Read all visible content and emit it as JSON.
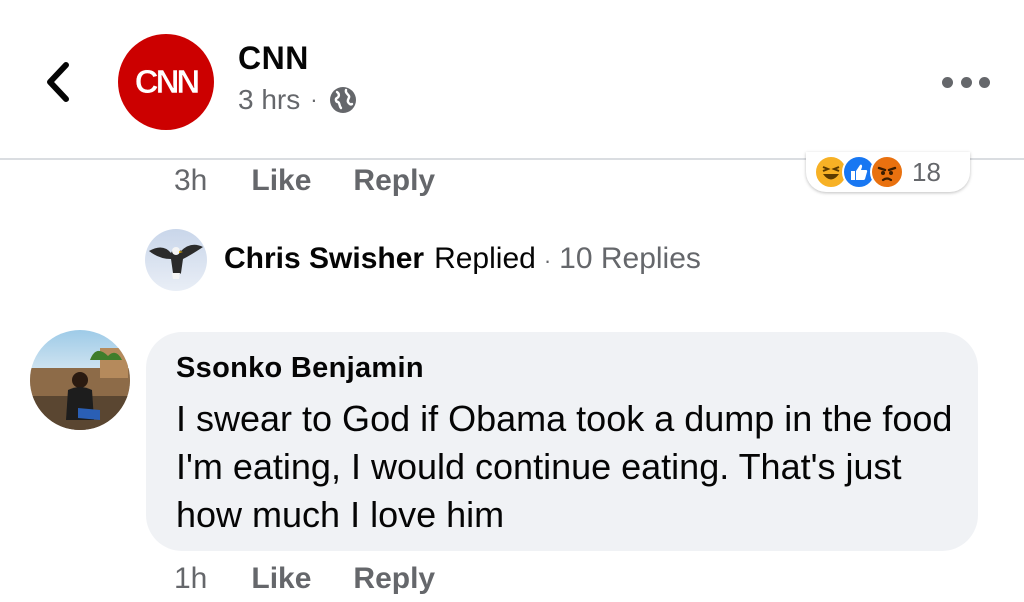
{
  "header": {
    "page_name": "CNN",
    "logo_text": "CNN",
    "time_ago": "3 hrs",
    "separator": "·",
    "back_icon": "chevron-left-icon",
    "privacy_icon": "globe-icon",
    "more_icon": "more-horizontal-icon"
  },
  "first_comment": {
    "time": "3h",
    "like_label": "Like",
    "reply_label": "Reply",
    "reactions": {
      "icons": [
        "haha-icon",
        "like-icon",
        "angry-icon"
      ],
      "count": "18",
      "colors": {
        "haha": "#f7b125",
        "like": "#1877f2",
        "angry": "#e9710f"
      }
    }
  },
  "replies_summary": {
    "name": "Chris Swisher",
    "action": "Replied",
    "separator": "·",
    "replies": "10 Replies"
  },
  "second_comment": {
    "author": "Ssonko Benjamin",
    "text": "I swear to God if Obama took a dump in the food I'm eating, I would continue eating. That's just how much I love him",
    "time": "1h",
    "like_label": "Like",
    "reply_label": "Reply"
  },
  "colors": {
    "brand_red": "#cc0000",
    "meta_gray": "#65676b",
    "bubble_bg": "#f0f2f5"
  }
}
